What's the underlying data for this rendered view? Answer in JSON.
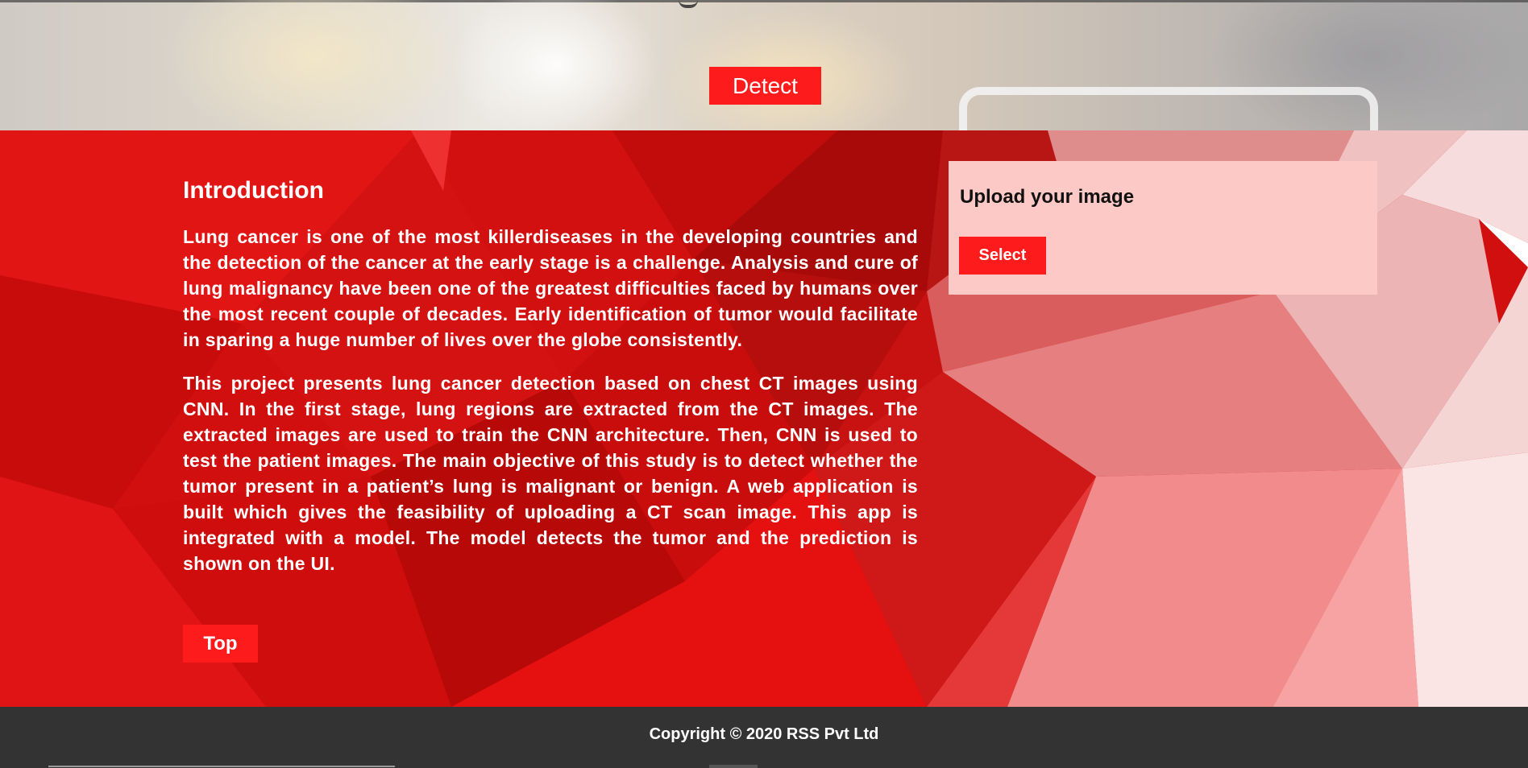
{
  "hero": {
    "detect_label": "Detect"
  },
  "intro": {
    "heading": "Introduction",
    "paragraphs": [
      "Lung cancer is one of the most killerdiseases in the developing countries and the detection of the cancer at the early stage is a challenge. Analysis and cure of lung malignancy have been one of the greatest difficulties faced by humans over the most recent couple of decades. Early identification of tumor would facilitate in sparing a huge number of lives over the globe consistently.",
      "This project presents lung cancer detection based on chest CT images using CNN. In the first stage, lung regions are extracted from the CT images. The extracted images are used to train the CNN architecture. Then, CNN is used to test the patient images. The main objective of this study is to detect whether the tumor present in a patient’s lung is malignant or benign. A web application is built which gives the feasibility of uploading a CT scan image. This app is integrated with a model. The model detects the tumor and the prediction is shown on the UI."
    ],
    "top_label": "Top"
  },
  "upload": {
    "heading": "Upload your image",
    "select_label": "Select"
  },
  "footer": {
    "copyright": "Copyright © 2020 RSS Pvt Ltd"
  },
  "colors": {
    "accent": "#fd1b1b",
    "section_red": "#d40f0f",
    "upload_card": "#fdc9c6",
    "footer": "#333333"
  }
}
